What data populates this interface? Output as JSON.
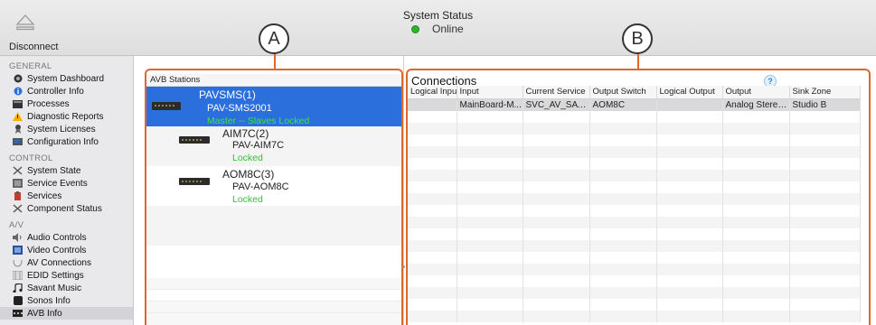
{
  "header": {
    "disconnect_label": "Disconnect",
    "status_title": "System Status",
    "status_value": "Online"
  },
  "callouts": {
    "a": "A",
    "b": "B"
  },
  "sidebar": {
    "general": {
      "heading": "GENERAL",
      "items": [
        {
          "label": "System Dashboard",
          "icon": "dashboard-icon"
        },
        {
          "label": "Controller Info",
          "icon": "info-icon"
        },
        {
          "label": "Processes",
          "icon": "processes-icon"
        },
        {
          "label": "Diagnostic Reports",
          "icon": "warning-icon"
        },
        {
          "label": "System Licenses",
          "icon": "license-icon"
        },
        {
          "label": "Configuration Info",
          "icon": "config-icon"
        }
      ]
    },
    "control": {
      "heading": "CONTROL",
      "items": [
        {
          "label": "System State",
          "icon": "tools-icon"
        },
        {
          "label": "Service Events",
          "icon": "events-icon"
        },
        {
          "label": "Services",
          "icon": "services-icon"
        },
        {
          "label": "Component Status",
          "icon": "tools-icon"
        }
      ]
    },
    "av": {
      "heading": "A/V",
      "items": [
        {
          "label": "Audio Controls",
          "icon": "speaker-icon"
        },
        {
          "label": "Video Controls",
          "icon": "video-icon"
        },
        {
          "label": "AV Connections",
          "icon": "connections-icon"
        },
        {
          "label": "EDID Settings",
          "icon": "edid-icon"
        },
        {
          "label": "Savant Music",
          "icon": "music-icon"
        },
        {
          "label": "Sonos Info",
          "icon": "sonos-icon"
        },
        {
          "label": "AVB Info",
          "icon": "avb-icon"
        }
      ]
    }
  },
  "avb": {
    "header": "AVB Stations",
    "stations": [
      {
        "name": "PAVSMS(1)",
        "model": "PAV-SMS2001",
        "status": "Master -- Slaves Locked"
      },
      {
        "name": "AIM7C(2)",
        "model": "PAV-AIM7C",
        "status": "Locked"
      },
      {
        "name": "AOM8C(3)",
        "model": "PAV-AOM8C",
        "status": "Locked"
      }
    ]
  },
  "connections": {
    "title": "Connections",
    "help": "?",
    "columns": [
      "Logical Input",
      "Input",
      "Current Service",
      "Output Switch",
      "Logical Output",
      "Output",
      "Sink Zone"
    ],
    "rows": [
      [
        "",
        "MainBoard-M...",
        "SVC_AV_SAVA...",
        "AOM8C",
        "",
        "Analog Stereo...",
        "Studio B"
      ]
    ]
  },
  "colors": {
    "accent_orange": "#e0672b",
    "selection_blue": "#2a6fdb",
    "locked_green": "#2ec22e",
    "online_green": "#2fb32f"
  }
}
